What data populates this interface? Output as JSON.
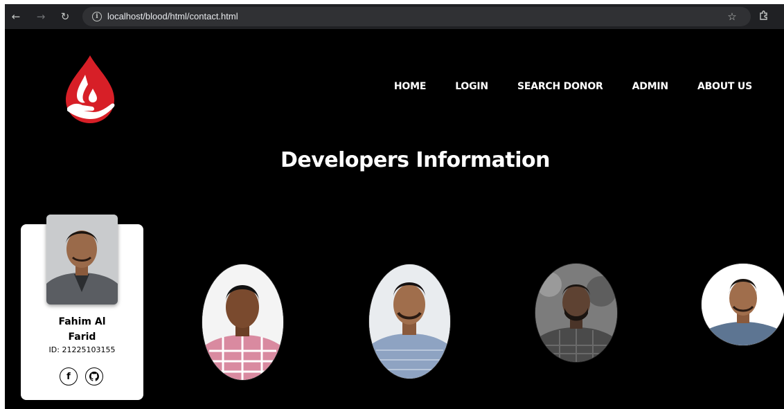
{
  "browser": {
    "url": "localhost/blood/html/contact.html",
    "back_icon": "arrow-left-icon",
    "forward_icon": "arrow-right-icon",
    "reload_icon": "reload-icon",
    "bookmark_icon": "star-icon",
    "extensions_icon": "puzzle-icon"
  },
  "nav": {
    "items": [
      "HOME",
      "LOGIN",
      "SEARCH DONOR",
      "ADMIN",
      "ABOUT US"
    ]
  },
  "page": {
    "title": "Developers Information"
  },
  "featured_developer": {
    "name_line1": "Fahim Al",
    "name_line2": "Farid",
    "id": "ID: 21225103155",
    "socials": [
      "facebook-icon",
      "github-icon"
    ]
  },
  "colors": {
    "background": "#000000",
    "logo_red": "#d71f27",
    "text_light": "#ffffff"
  }
}
